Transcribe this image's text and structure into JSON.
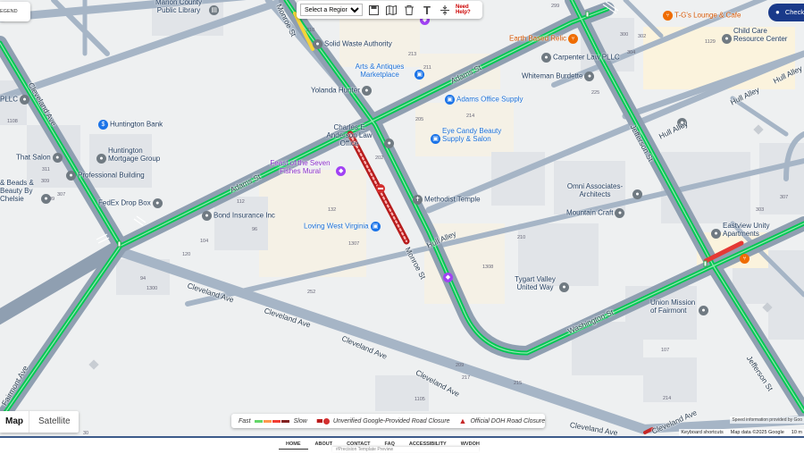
{
  "toolbar": {
    "legend_label": "EGEND",
    "region_select": "Select a Region",
    "help_label": "Need Help?"
  },
  "top_right_button": "Check",
  "map_type": {
    "map": "Map",
    "satellite": "Satellite"
  },
  "legend": {
    "fast": "Fast",
    "slow": "Slow",
    "unverified": "Unverified Google-Provided Road Closure",
    "official": "Official DOH Road Closure",
    "speed_colors": [
      "#63d668",
      "#ff974d",
      "#f23c32",
      "#811f1f"
    ]
  },
  "attribution": {
    "speed_info": "Speed information provided by Goo",
    "shortcuts": "Keyboard shortcuts",
    "map_data": "Map data ©2025 Google",
    "scale": "10 m"
  },
  "footer": {
    "nav": [
      "HOME",
      "ABOUT",
      "CONTACT",
      "FAQ",
      "ACCESSIBILITY",
      "WVDOH"
    ],
    "preview": "#Precision Template Preview"
  },
  "places": {
    "marion_county": "Marion County Public Library",
    "solid_waste": "Solid Waste Authority",
    "arts_antiques": "Arts & Antiques Marketplace",
    "yolanda": "Yolanda Hunter",
    "charles": "Charles E Anderson Law Office",
    "feast": "Feast of the Seven Fishes Mural",
    "huntington_bank": "Huntington Bank",
    "huntington_mortgage": "Huntington Mortgage Group",
    "professional": "Professional Building",
    "that_salon": "That Salon",
    "beads": "& Beads & Beauty By Chelsie",
    "pllc": "PLLC",
    "fedex": "FedEx Drop Box",
    "bond": "Bond Insurance Inc",
    "loving_wv": "Loving West Virginia",
    "methodist": "Methodist Temple",
    "adams_supply": "Adams Office Supply",
    "eye_candy": "Eye Candy Beauty Supply & Salon",
    "whiteman": "Whiteman Burdette",
    "carpenter": "Carpenter Law PLLC",
    "earth_based": "Earth Based Relic",
    "tgs": "T-G's Lounge & Cafe",
    "child_care": "Child Care Resource Center",
    "omni": "Omni Associates-Architects",
    "mountain_craft": "Mountain Craft",
    "tygart": "Tygart Valley United Way",
    "union_mission": "Union Mission of Fairmont",
    "eastview": "Eastview Unity Apartments"
  },
  "streets": {
    "adams_1": "Adams St",
    "adams_2": "Adams St",
    "cleveland_1": "Cleveland Ave",
    "cleveland_2": "Cleveland Ave",
    "cleveland_3": "Cleveland Ave",
    "cleveland_4": "Cleveland Ave",
    "cleveland_5": "Cleveland Ave",
    "cleveland_6": "Cleveland Ave",
    "cleveland_7": "Cleveland Ave",
    "jefferson_1": "Jefferson St",
    "jefferson_2": "Jefferson St",
    "monroe_1": "Monroe St",
    "monroe_2": "Monroe St",
    "washington": "Washington St",
    "hull_1": "Hull Alley",
    "hull_2": "Hull Alley",
    "hull_3": "Hull Alley",
    "hull_4": "Hull Alley",
    "fairmont": "Fairmont Ave"
  },
  "numbers": {
    "n299": "299",
    "n310": "310",
    "n213": "213",
    "n211": "211",
    "n300": "300",
    "n302": "302",
    "n304": "304",
    "n1129": "1129",
    "n225": "225",
    "n214": "214",
    "n205": "205",
    "n1108": "1108",
    "n311": "311",
    "n309": "309",
    "n307": "307",
    "n99": "99",
    "n202": "202",
    "n112": "112",
    "n132": "132",
    "n104": "104",
    "n96": "96",
    "n120": "120",
    "n1307": "1307",
    "n210": "210",
    "n1308": "1308",
    "n303": "303",
    "n307b": "307",
    "n94": "94",
    "n1300": "1300",
    "n252": "252",
    "n107": "107",
    "n209": "209",
    "n217": "217",
    "n215": "215",
    "n1105": "1105",
    "n214b": "214",
    "n30": "30"
  }
}
